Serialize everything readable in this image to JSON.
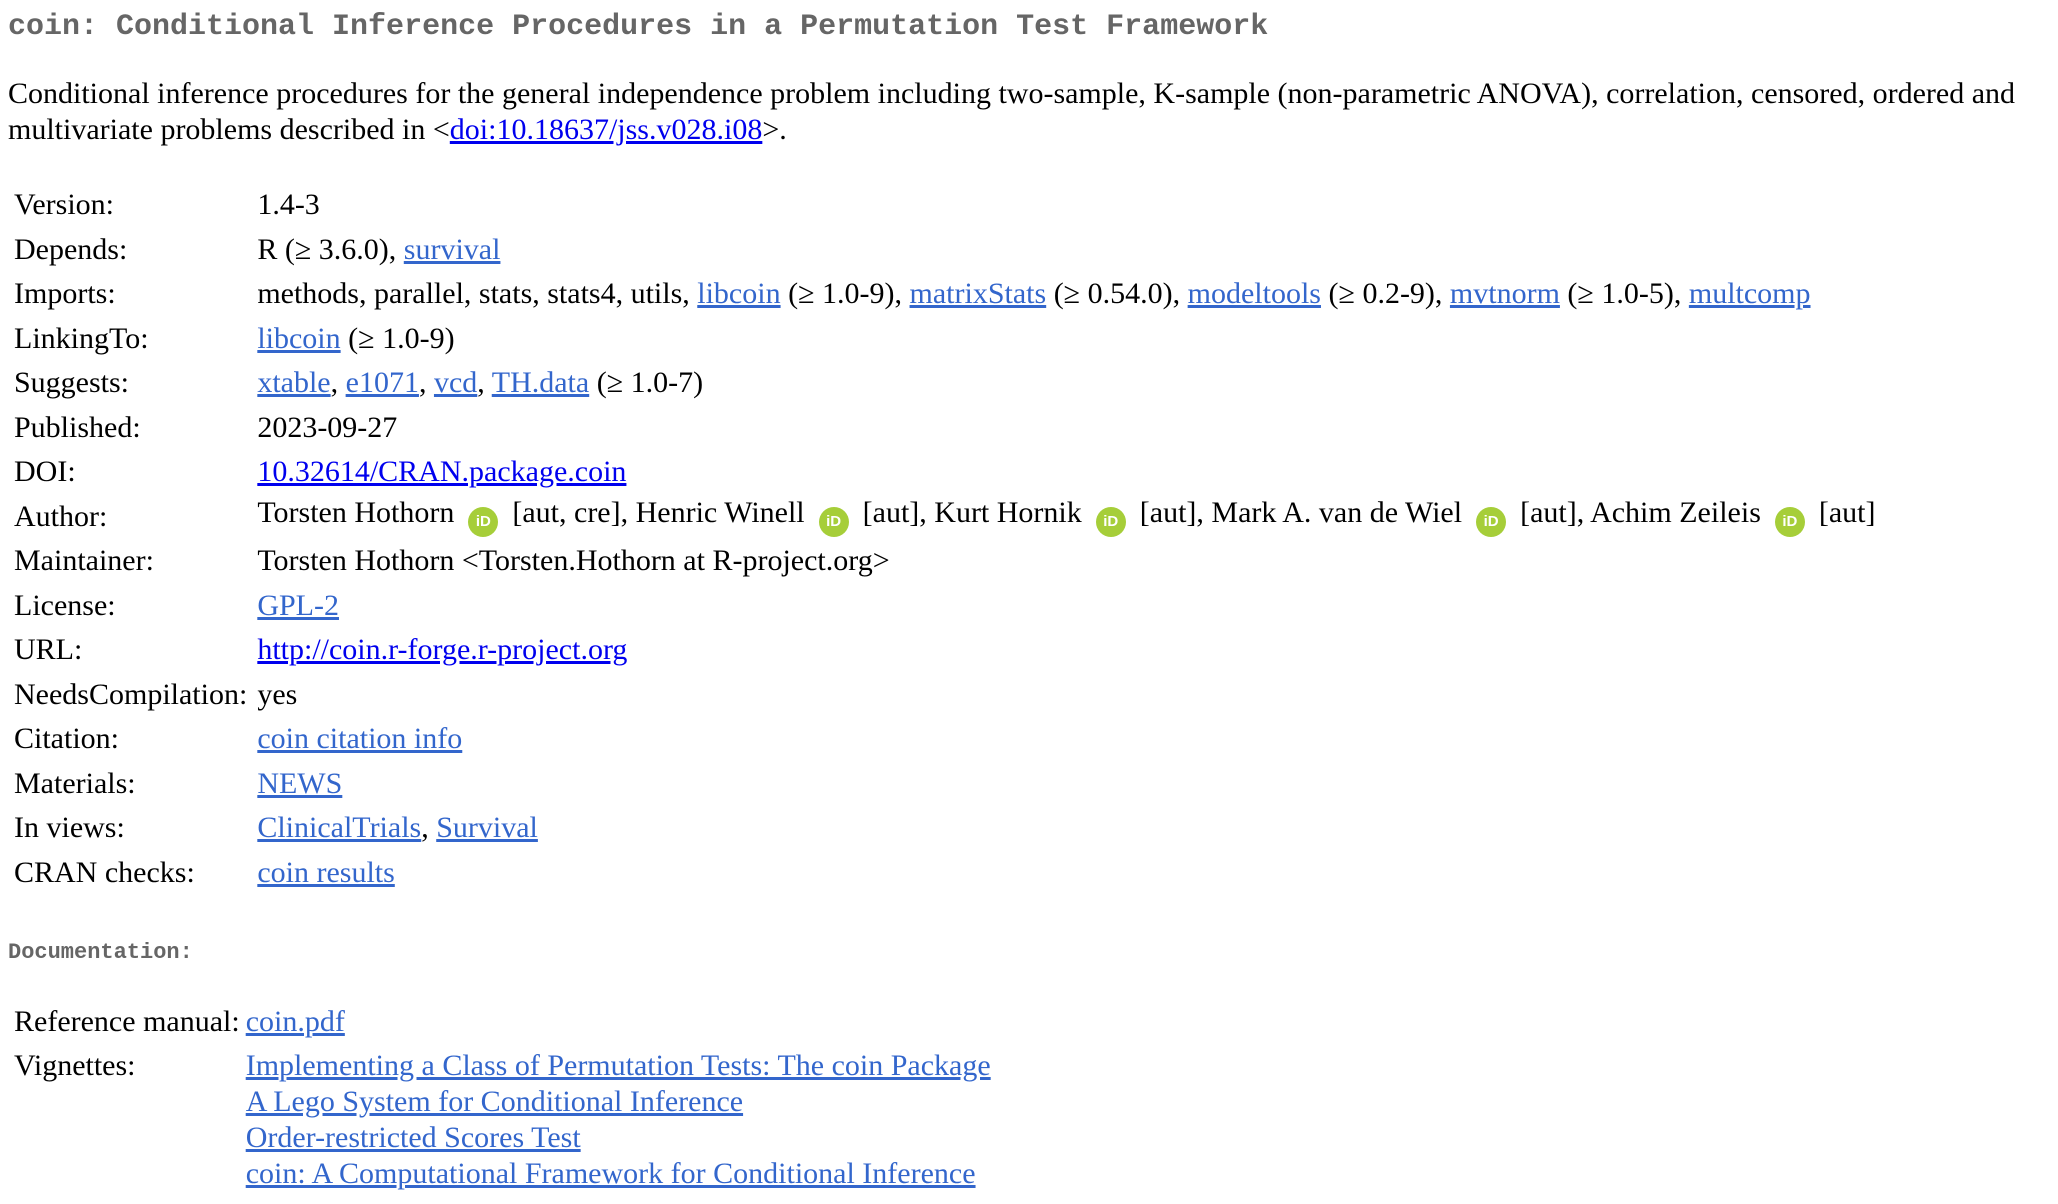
{
  "title": "coin: Conditional Inference Procedures in a Permutation Test Framework",
  "description": {
    "text": "Conditional inference procedures for the general independence problem including two-sample, K-sample (non-parametric ANOVA), correlation, censored, ordered and multivariate problems described in <",
    "doi_link": "doi:10.18637/jss.v028.i08",
    "suffix": ">."
  },
  "meta": {
    "version": {
      "label": "Version:",
      "value": "1.4-3"
    },
    "depends": {
      "label": "Depends:",
      "prefix": "R (≥ 3.6.0), ",
      "link": "survival"
    },
    "imports": {
      "label": "Imports:",
      "prefix": "methods, parallel, stats, stats4, utils, ",
      "items": [
        {
          "link": "libcoin",
          "suffix": " (≥ 1.0-9), "
        },
        {
          "link": "matrixStats",
          "suffix": " (≥ 0.54.0), "
        },
        {
          "link": "modeltools",
          "suffix": " (≥ 0.2-9), "
        },
        {
          "link": "mvtnorm",
          "suffix": " (≥ 1.0-5), "
        },
        {
          "link": "multcomp",
          "suffix": ""
        }
      ]
    },
    "linkingto": {
      "label": "LinkingTo:",
      "link": "libcoin",
      "suffix": " (≥ 1.0-9)"
    },
    "suggests": {
      "label": "Suggests:",
      "items": [
        {
          "link": "xtable",
          "suffix": ", "
        },
        {
          "link": "e1071",
          "suffix": ", "
        },
        {
          "link": "vcd",
          "suffix": ", "
        },
        {
          "link": "TH.data",
          "suffix": " (≥ 1.0-7)"
        }
      ]
    },
    "published": {
      "label": "Published:",
      "value": "2023-09-27"
    },
    "doi": {
      "label": "DOI:",
      "link": "10.32614/CRAN.package.coin"
    },
    "author": {
      "label": "Author:",
      "orcid_glyph": "iD",
      "people": [
        {
          "name": "Torsten Hothorn",
          "role": "[aut, cre], "
        },
        {
          "name": "Henric Winell",
          "role": "[aut], "
        },
        {
          "name": "Kurt Hornik",
          "role": "[aut], "
        },
        {
          "name": "Mark A. van de Wiel",
          "role": "[aut], "
        },
        {
          "name": "Achim Zeileis",
          "role": "[aut]"
        }
      ]
    },
    "maintainer": {
      "label": "Maintainer:",
      "value": "Torsten Hothorn <Torsten.Hothorn at R-project.org>"
    },
    "license": {
      "label": "License:",
      "link": "GPL-2"
    },
    "url": {
      "label": "URL:",
      "link": "http://coin.r-forge.r-project.org"
    },
    "needscompilation": {
      "label": "NeedsCompilation:",
      "value": "yes"
    },
    "citation": {
      "label": "Citation:",
      "link": "coin citation info"
    },
    "materials": {
      "label": "Materials:",
      "link": "NEWS"
    },
    "inviews": {
      "label": "In views:",
      "links": [
        "ClinicalTrials",
        "Survival"
      ],
      "separator": ", "
    },
    "cranchecks": {
      "label": "CRAN checks:",
      "link": "coin results"
    }
  },
  "documentation": {
    "heading": "Documentation:",
    "refman": {
      "label": "Reference manual:",
      "link": "coin.pdf"
    },
    "vignettes": {
      "label": "Vignettes:",
      "links": [
        "Implementing a Class of Permutation Tests: The coin Package",
        "A Lego System for Conditional Inference",
        "Order-restricted Scores Test",
        "coin: A Computational Framework for Conditional Inference"
      ]
    }
  },
  "colors": {
    "link": "#3366cc",
    "plain_link": "#0000ee",
    "heading": "#666666",
    "orcid": "#a6ce39"
  }
}
